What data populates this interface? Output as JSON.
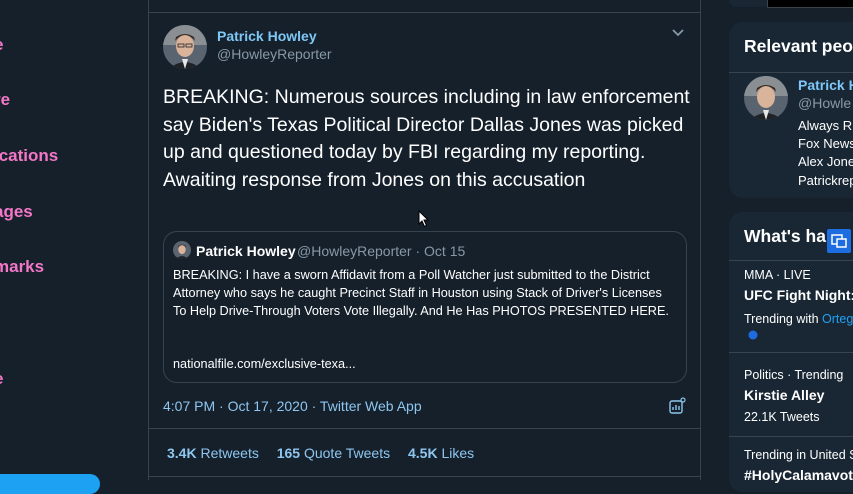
{
  "left_nav": {
    "items": [
      "e",
      "re",
      "ications",
      "ages",
      "marks",
      "e"
    ],
    "accent_color": "#f277c6"
  },
  "tweet": {
    "author_name": "Patrick Howley",
    "author_handle": "@HowleyReporter",
    "text": "BREAKING: Numerous sources including in law enforcement say Biden's Texas Political Director Dallas Jones was picked up and questioned today by FBI regarding my reporting. Awaiting response from Jones on this accusation",
    "quote": {
      "author_name": "Patrick Howley",
      "author_handle_date": "@HowleyReporter · Oct 15",
      "text": "BREAKING: I have a sworn Affidavit from a Poll Watcher just submitted to the District Attorney who says he caught Precinct Staff in Houston using Stack of Driver's Licenses To Help Drive-Through Voters Vote Illegally. And He Has PHOTOS PRESENTED HERE.",
      "link": "nationalfile.com/exclusive-texa..."
    },
    "meta": "4:07 PM · Oct 17, 2020 · Twitter Web App",
    "stats": {
      "retweets_count": "3.4K",
      "retweets_label": "Retweets",
      "quotes_count": "165",
      "quotes_label": "Quote Tweets",
      "likes_count": "4.5K",
      "likes_label": "Likes"
    }
  },
  "right": {
    "relevant": {
      "title": "Relevant peop",
      "name": "Patrick H",
      "handle": "@Howle",
      "bio": [
        "Always R",
        "Fox News",
        "Alex Jone",
        "Patrickrep"
      ]
    },
    "trends": {
      "title": "What's ha",
      "items": [
        {
          "meta": "MMA · LIVE",
          "title": "UFC Fight Night:",
          "sub_prefix": "Trending with ",
          "sub_highlight": "Ortega"
        },
        {
          "meta": "Politics · Trending",
          "title": "Kirstie Alley",
          "sub": "22.1K Tweets"
        },
        {
          "meta": "Trending in United S",
          "title": "#HolyCalamavote"
        }
      ]
    }
  },
  "colors": {
    "background": "#15202b",
    "card": "#192734",
    "border": "#38444d",
    "link": "#8ec6ef",
    "muted": "#8899a6",
    "nav_pink": "#f277c6"
  }
}
